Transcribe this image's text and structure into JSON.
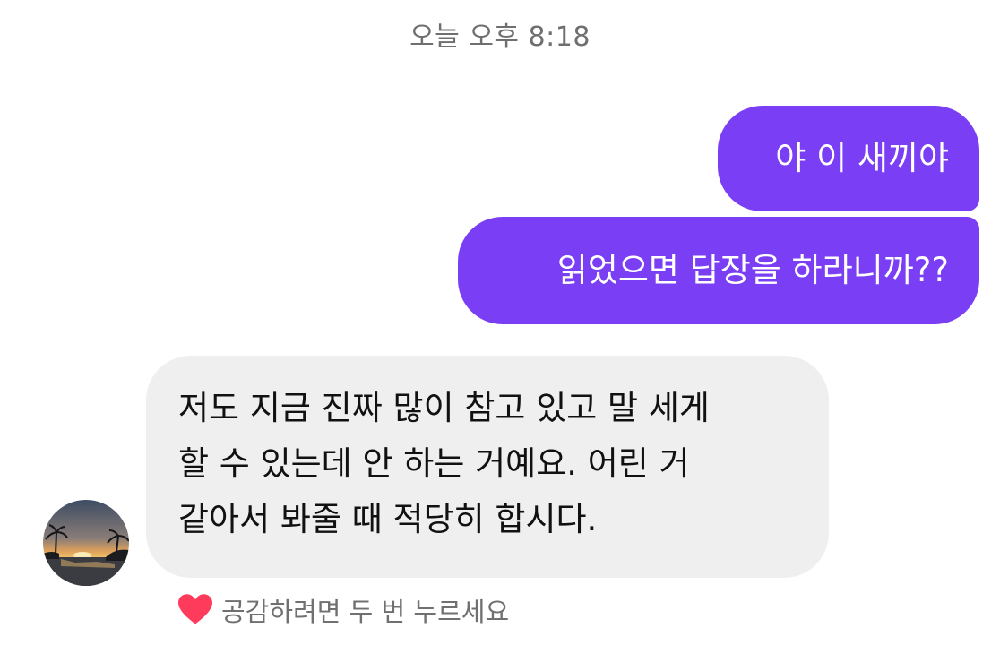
{
  "timestamp": "오늘 오후 8:18",
  "messages": {
    "sent": [
      {
        "text": "야 이 새끼야"
      },
      {
        "text": "읽었으면 답장을 하라니까??"
      }
    ],
    "received": {
      "lines": [
        "저도 지금 진짜 많이 참고 있고 말 세게",
        "할 수 있는데 안 하는 거예요. 어린 거",
        "같아서 봐줄 때 적당히 합시다."
      ]
    }
  },
  "reaction_hint": {
    "icon": "heart-icon",
    "text": "공감하려면 두 번 누르세요"
  },
  "colors": {
    "sent_bubble": "#7a3ff5",
    "received_bubble": "#efefef",
    "heart": "#ff3b5c"
  }
}
